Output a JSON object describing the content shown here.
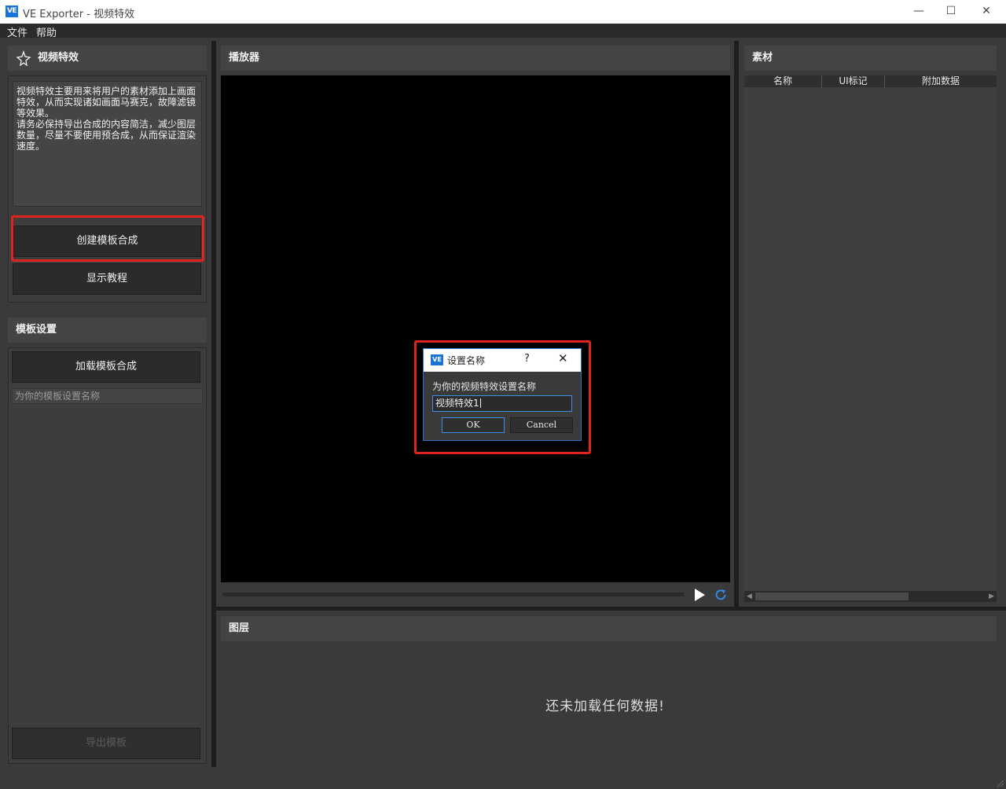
{
  "window": {
    "logo_text": "VE",
    "title": "VE Exporter - 视频特效",
    "minimize": "—",
    "maximize": "☐",
    "close": "✕"
  },
  "menu": {
    "items": [
      "文件",
      "帮助"
    ]
  },
  "left_panel": {
    "header": "视频特效",
    "description": "视频特效主要用来将用户的素材添加上画面特效，从而实现诸如画面马赛克，故障滤镜等效果。\n请务必保持导出合成的内容简洁，减少图层数量，尽量不要使用预合成，从而保证渲染速度。",
    "create_button": "创建模板合成",
    "tutorial_button": "显示教程"
  },
  "template_panel": {
    "header": "模板设置",
    "load_button": "加载模板合成",
    "name_placeholder": "为你的模板设置名称",
    "export_button": "导出模板"
  },
  "player": {
    "header": "播放器"
  },
  "assets": {
    "header": "素材",
    "columns": [
      "名称",
      "UI标记",
      "附加数据"
    ]
  },
  "layers": {
    "header": "图层",
    "empty_message": "还未加载任何数据!"
  },
  "dialog": {
    "logo_text": "VE",
    "title": "设置名称",
    "help": "?",
    "close": "✕",
    "prompt": "为你的视频特效设置名称",
    "value": "视频特效1",
    "ok": "OK",
    "cancel": "Cancel"
  }
}
